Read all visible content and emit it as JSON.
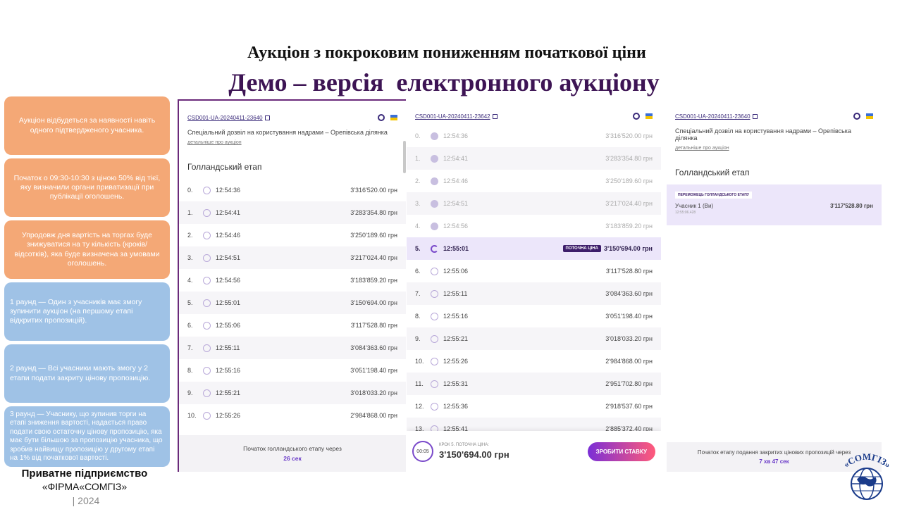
{
  "header": {
    "title_line1": "Аукціон з покроковим пониженням початкової ціни",
    "title_line2": "Демо – версія  електронного аукціону"
  },
  "info_boxes": [
    {
      "text": "Аукціон відбудеться за наявності навіть одного підтвердженого учасника.",
      "color": "orange"
    },
    {
      "text": "Початок о 09:30-10:30 з ціною 50% від тієї, яку визначили органи приватизації при публікації оголошень.",
      "color": "orange"
    },
    {
      "text": "Упродовж дня вартість на торгах буде знижуватися на ту кількість (кроків/відсотків), яка буде визначена за умовами оголошень.",
      "color": "orange"
    },
    {
      "text": "1 раунд — Один з учасників має змогу зупинити аукціон (на першому етапі відкритих пропозицій).",
      "color": "blue"
    },
    {
      "text": "2 раунд — Всі учасники мають змогу у 2 етапи подати закриту цінову пропозицію.",
      "color": "blue"
    },
    {
      "text": "3 раунд — Учаснику, що зупинив торги на етапі зниження вартості, надається право подати свою остаточну цінову пропозицію, яка має бути більшою за пропозицію учасника, що зробив найвищу пропозицію у другому етапі на 1% від початкової вартості.",
      "color": "blue"
    }
  ],
  "company": {
    "line1": "Приватне підприємство",
    "line2": "«ФІРМА«СОМГІЗ»",
    "line3": "| 2024"
  },
  "panel1": {
    "auction_id": "CSD001-UA-20240411-23640",
    "description": "Спеціальний дозвіл на користування надрами – Орепівська ділянка",
    "details_link": "детальніше про аукціон",
    "stage_title": "Голландський етап",
    "rows": [
      {
        "idx": "0.",
        "time": "12:54:36",
        "price": "3'316'520.00 грн"
      },
      {
        "idx": "1.",
        "time": "12:54:41",
        "price": "3'283'354.80 грн"
      },
      {
        "idx": "2.",
        "time": "12:54:46",
        "price": "3'250'189.60 грн"
      },
      {
        "idx": "3.",
        "time": "12:54:51",
        "price": "3'217'024.40 грн"
      },
      {
        "idx": "4.",
        "time": "12:54:56",
        "price": "3'183'859.20 грн"
      },
      {
        "idx": "5.",
        "time": "12:55:01",
        "price": "3'150'694.00 грн"
      },
      {
        "idx": "6.",
        "time": "12:55:06",
        "price": "3'117'528.80 грн"
      },
      {
        "idx": "7.",
        "time": "12:55:11",
        "price": "3'084'363.60 грн"
      },
      {
        "idx": "8.",
        "time": "12:55:16",
        "price": "3'051'198.40 грн"
      },
      {
        "idx": "9.",
        "time": "12:55:21",
        "price": "3'018'033.20 грн"
      },
      {
        "idx": "10.",
        "time": "12:55:26",
        "price": "2'984'868.00 грн"
      }
    ],
    "footer_text": "Початок голландського етапу через",
    "footer_countdown": "26 сек"
  },
  "panel2": {
    "auction_id": "CSD001-UA-20240411-23642",
    "current_badge": "ПОТОЧНА ЦІНА",
    "rows": [
      {
        "idx": "0.",
        "time": "12:54:36",
        "price": "3'316'520.00 грн",
        "state": "dim"
      },
      {
        "idx": "1.",
        "time": "12:54:41",
        "price": "3'283'354.80 грн",
        "state": "dim"
      },
      {
        "idx": "2.",
        "time": "12:54:46",
        "price": "3'250'189.60 грн",
        "state": "dim"
      },
      {
        "idx": "3.",
        "time": "12:54:51",
        "price": "3'217'024.40 грн",
        "state": "dim"
      },
      {
        "idx": "4.",
        "time": "12:54:56",
        "price": "3'183'859.20 грн",
        "state": "dim"
      },
      {
        "idx": "5.",
        "time": "12:55:01",
        "price": "3'150'694.00 грн",
        "state": "current"
      },
      {
        "idx": "6.",
        "time": "12:55:06",
        "price": "3'117'528.80 грн",
        "state": ""
      },
      {
        "idx": "7.",
        "time": "12:55:11",
        "price": "3'084'363.60 грн",
        "state": ""
      },
      {
        "idx": "8.",
        "time": "12:55:16",
        "price": "3'051'198.40 грн",
        "state": ""
      },
      {
        "idx": "9.",
        "time": "12:55:21",
        "price": "3'018'033.20 грн",
        "state": ""
      },
      {
        "idx": "10.",
        "time": "12:55:26",
        "price": "2'984'868.00 грн",
        "state": ""
      },
      {
        "idx": "11.",
        "time": "12:55:31",
        "price": "2'951'702.80 грн",
        "state": ""
      },
      {
        "idx": "12.",
        "time": "12:55:36",
        "price": "2'918'537.60 грн",
        "state": ""
      },
      {
        "idx": "13.",
        "time": "12:55:41",
        "price": "2'885'372.40 грн",
        "state": ""
      }
    ],
    "timer": "00:05",
    "step_caption": "КРОК 5. ПОТОЧНА ЦІНА:",
    "step_price": "3'150'694.00 грн",
    "bid_button": "ЗРОБИТИ СТАВКУ"
  },
  "panel3": {
    "auction_id": "CSD001-UA-20240411-23640",
    "description": "Спеціальний дозвіл на користування надрами – Орепівська ділянка",
    "details_link": "детальніше про аукціон",
    "stage_title": "Голландський етап",
    "winner_tag": "ПЕРЕМОЖЕЦЬ ГОЛЛАНДСЬКОГО ЕТАПУ",
    "winner_name": "Учасник 1 (Ви)",
    "winner_price": "3'117'528.80 грн",
    "winner_time": "12:55:06.428",
    "footer_text": "Початок етапу подання закритих цінових пропозицій через",
    "footer_countdown": "7 хв 47 сек"
  },
  "logo_text": "«СОМГІЗ»",
  "colors": {
    "orange": "#f4a876",
    "blue": "#9fc2e6",
    "accent": "#3d1454"
  }
}
